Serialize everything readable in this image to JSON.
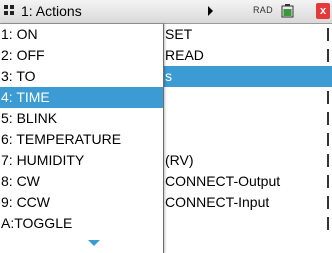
{
  "titlebar": {
    "title": "1: Actions",
    "mode": "RAD",
    "icons": [
      "menu-grid-icon",
      "submenu-arrow-icon",
      "battery-icon",
      "close-icon"
    ],
    "close_label": "x"
  },
  "background_menu": {
    "rows": [
      {
        "label": "SET",
        "selected": false
      },
      {
        "label": "READ",
        "selected": false
      },
      {
        "label": "s",
        "selected": true
      },
      {
        "label": "",
        "selected": false
      },
      {
        "label": "",
        "selected": false
      },
      {
        "label": "",
        "selected": false
      },
      {
        "label": "(RV)",
        "selected": false
      },
      {
        "label": "CONNECT-Output",
        "selected": false
      },
      {
        "label": "CONNECT-Input",
        "selected": false
      },
      {
        "label": "",
        "selected": false
      }
    ]
  },
  "dropdown": {
    "items": [
      {
        "label": "1: ON",
        "selected": false
      },
      {
        "label": "2: OFF",
        "selected": false
      },
      {
        "label": "3: TO",
        "selected": false
      },
      {
        "label": "4: TIME",
        "selected": true
      },
      {
        "label": "5: BLINK",
        "selected": false
      },
      {
        "label": "6: TEMPERATURE",
        "selected": false
      },
      {
        "label": "7: HUMIDITY",
        "selected": false
      },
      {
        "label": "8: CW",
        "selected": false
      },
      {
        "label": "9: CCW",
        "selected": false
      },
      {
        "label": "A:TOGGLE",
        "selected": false
      }
    ]
  },
  "colors": {
    "selection": "#3d9bd3",
    "close_button": "#e53838"
  }
}
